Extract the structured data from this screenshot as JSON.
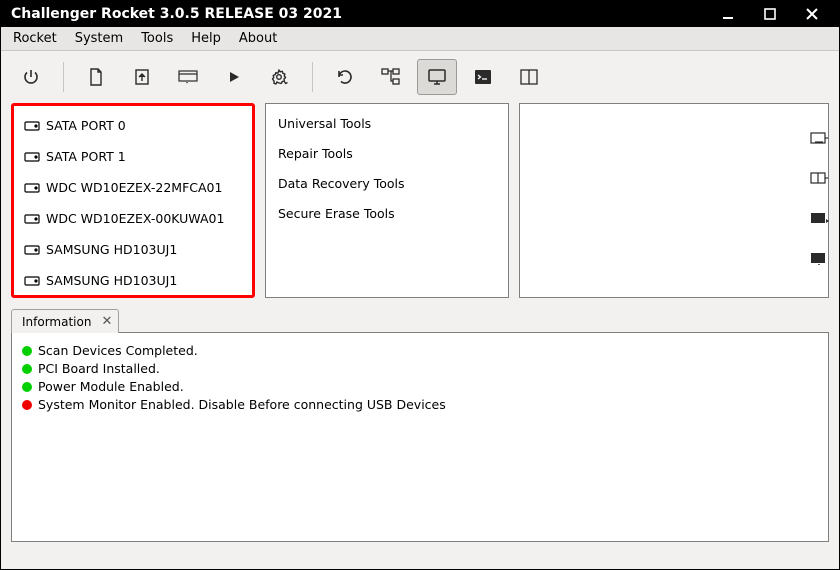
{
  "window": {
    "title": "Challenger Rocket 3.0.5 RELEASE 03 2021"
  },
  "menu": [
    "Rocket",
    "System",
    "Tools",
    "Help",
    "About"
  ],
  "toolbar_icons": [
    "power",
    "document",
    "upload",
    "window-split",
    "play",
    "gear",
    "refresh",
    "tree",
    "monitor",
    "terminal",
    "columns"
  ],
  "toolbar_active_index": 8,
  "devices": [
    "SATA PORT 0",
    "SATA PORT 1",
    "WDC WD10EZEX-22MFCA01",
    "WDC WD10EZEX-00KUWA01",
    "SAMSUNG HD103UJ1",
    "SAMSUNG HD103UJ1"
  ],
  "tools": [
    "Universal Tools",
    "Repair Tools",
    "Data Recovery Tools",
    "Secure Erase Tools"
  ],
  "tab": {
    "label": "Information"
  },
  "info": [
    {
      "status": "green",
      "text": "Scan Devices Completed."
    },
    {
      "status": "green",
      "text": "PCI Board Installed."
    },
    {
      "status": "green",
      "text": "Power Module Enabled."
    },
    {
      "status": "red",
      "text": "System Monitor Enabled. Disable Before connecting USB Devices"
    }
  ]
}
